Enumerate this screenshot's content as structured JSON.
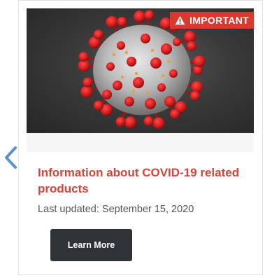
{
  "badge": {
    "label": "IMPORTANT",
    "icon": "warning-icon",
    "color": "#d9392e"
  },
  "hero": {
    "image_subject": "coronavirus-illustration"
  },
  "article": {
    "title": "Information about COVID-19 related products",
    "updated": "Last updated: September 15, 2020",
    "title_color": "#d9433a"
  },
  "actions": {
    "learn_more_label": "Learn More"
  },
  "nav": {
    "prev_icon": "chevron-left-icon",
    "accent": "#5b8fd6"
  }
}
